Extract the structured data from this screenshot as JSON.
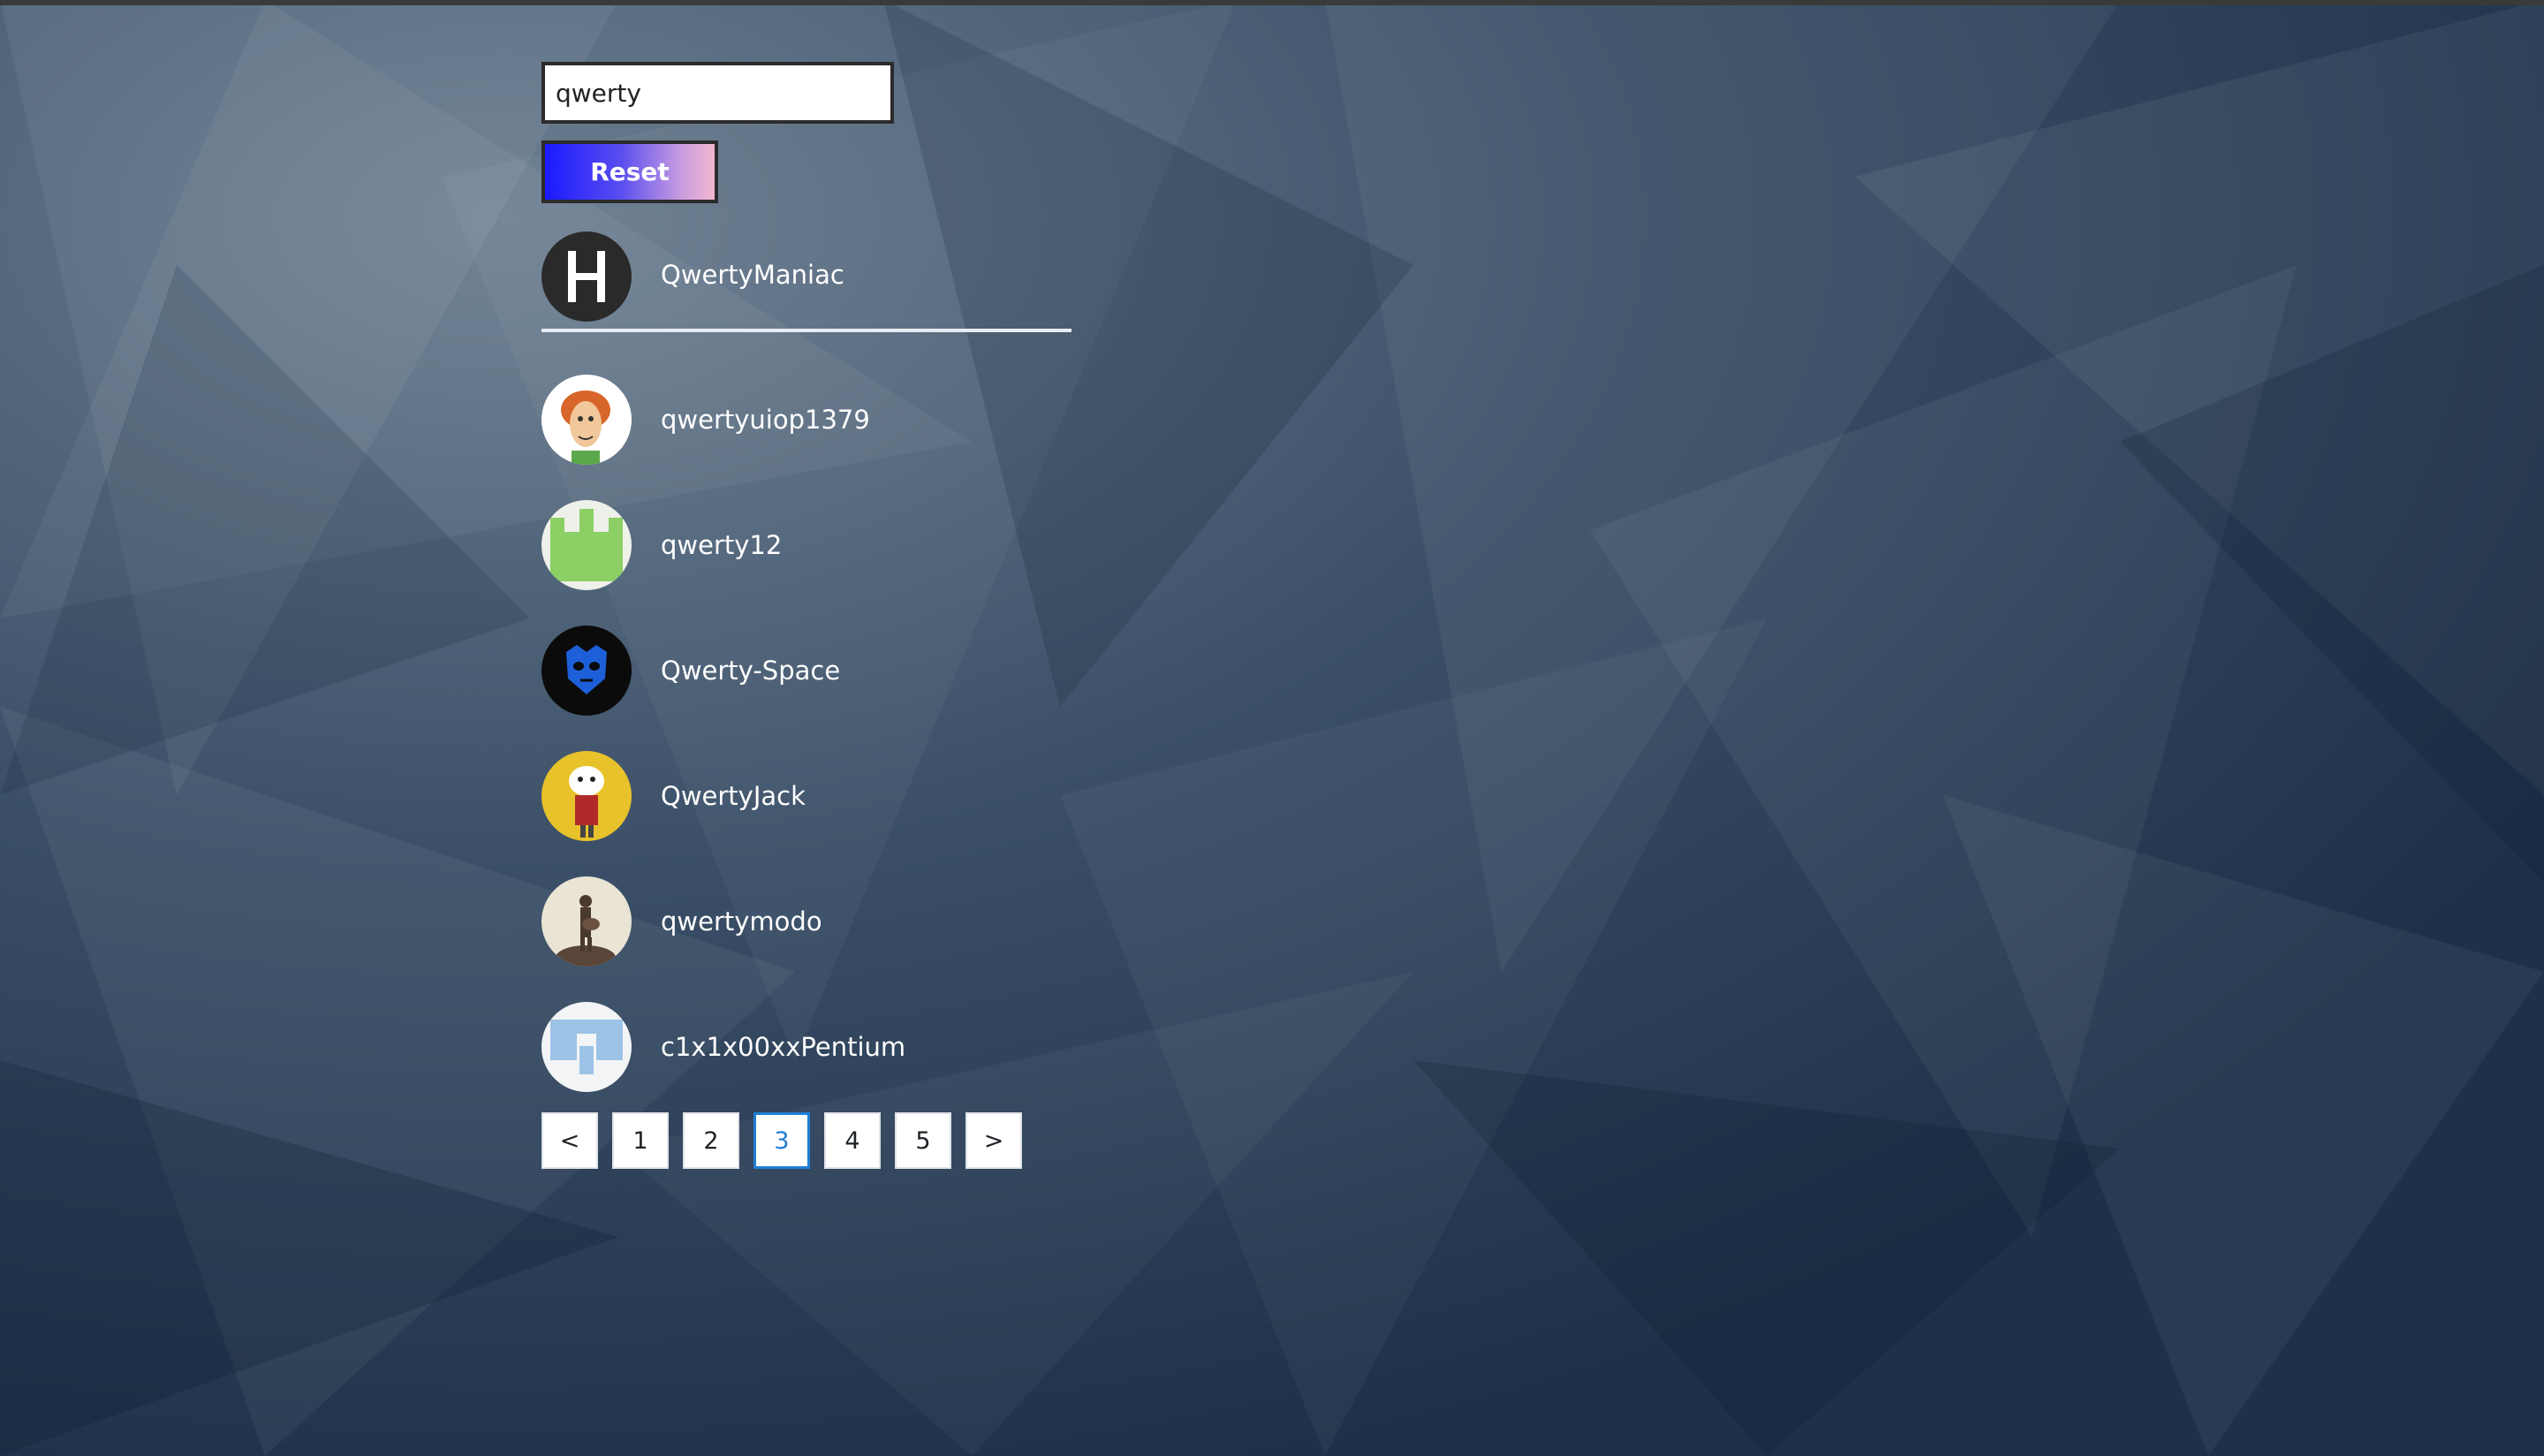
{
  "search": {
    "value": "qwerty"
  },
  "reset_label": "Reset",
  "users": [
    {
      "name": "QwertyManiac",
      "avatar_icon": "letter-h-avatar",
      "active": true
    },
    {
      "name": "qwertyuiop1379",
      "avatar_icon": "cartoon-redhead-avatar"
    },
    {
      "name": "qwerty12",
      "avatar_icon": "green-identicon-avatar"
    },
    {
      "name": "Qwerty-Space",
      "avatar_icon": "blue-mask-avatar"
    },
    {
      "name": "QwertyJack",
      "avatar_icon": "cartoon-character-yellow-avatar"
    },
    {
      "name": "qwertymodo",
      "avatar_icon": "guitarist-silhouette-avatar"
    },
    {
      "name": "c1x1x00xxPentium",
      "avatar_icon": "lightblue-identicon-avatar"
    }
  ],
  "pagination": {
    "prev_label": "<",
    "next_label": ">",
    "pages": [
      "1",
      "2",
      "3",
      "4",
      "5"
    ],
    "current_page": "3"
  },
  "colors": {
    "background": "#2a3d54",
    "active_page": "#1f7fd6",
    "reset_gradient_start": "#1a1aff",
    "reset_gradient_end": "#f2b6cf"
  }
}
